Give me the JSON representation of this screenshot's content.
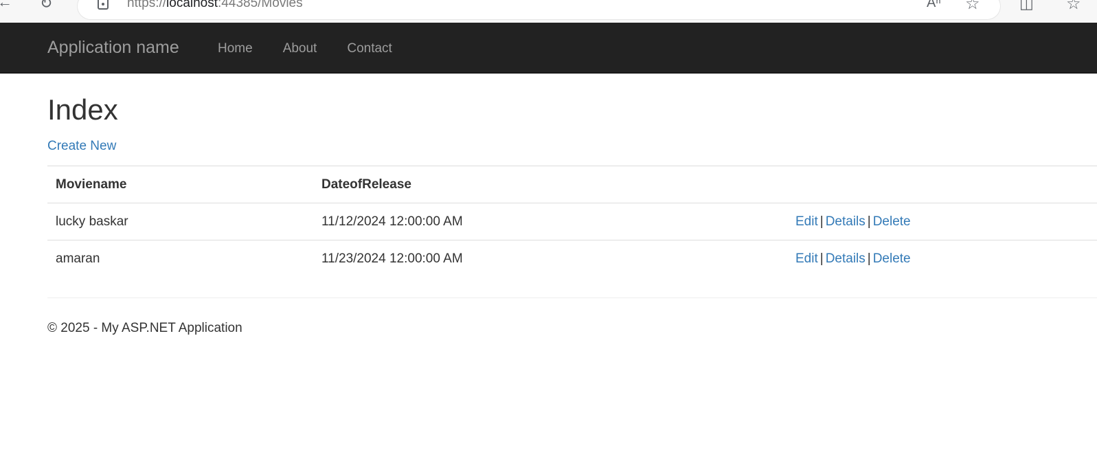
{
  "browser": {
    "url_prefix": "https://",
    "url_host": "localhost",
    "url_rest": ":44385/Movies",
    "icons": [
      "back-icon",
      "refresh-icon",
      "site-info-icon",
      "read-aloud-icon",
      "favorite-icon",
      "split-screen-icon",
      "favorites-bar-icon"
    ]
  },
  "navbar": {
    "brand": "Application name",
    "links": [
      "Home",
      "About",
      "Contact"
    ]
  },
  "main": {
    "title": "Index",
    "create_link": "Create New",
    "table": {
      "headers": [
        "Moviename",
        "DateofRelease"
      ],
      "rows": [
        {
          "name": "lucky baskar",
          "date": "11/12/2024 12:00:00 AM"
        },
        {
          "name": "amaran",
          "date": "11/23/2024 12:00:00 AM"
        }
      ],
      "actions": {
        "edit": "Edit",
        "details": "Details",
        "delete": "Delete",
        "separator": "|"
      }
    }
  },
  "footer": {
    "text": "© 2025 - My ASP.NET Application"
  },
  "colors": {
    "navbar_bg": "#222222",
    "nav_text": "#9d9d9d",
    "link": "#337ab7",
    "text": "#333333"
  }
}
